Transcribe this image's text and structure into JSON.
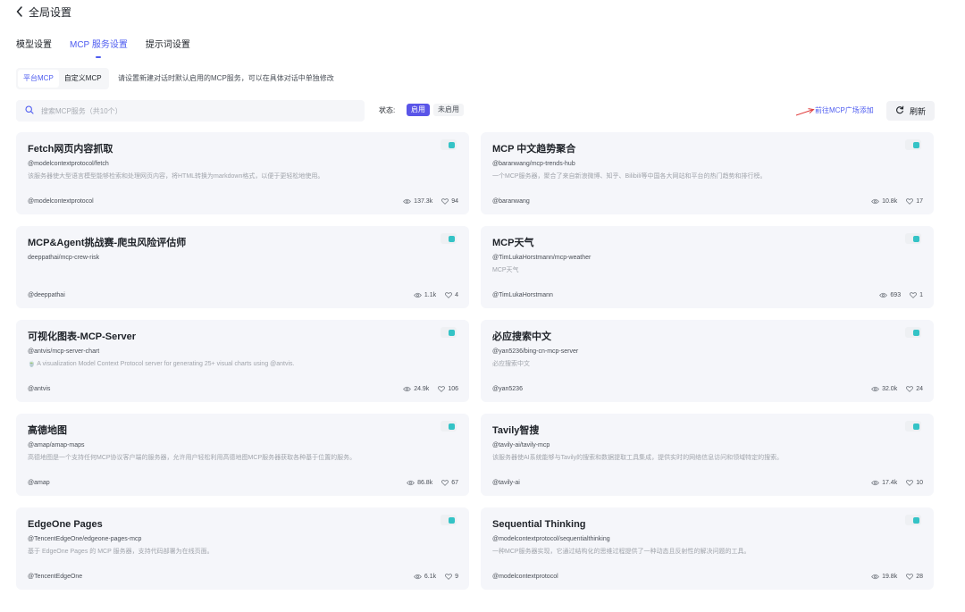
{
  "header": {
    "back_title": "全局设置"
  },
  "tabs": [
    {
      "label": "模型设置",
      "active": false
    },
    {
      "label": "MCP 服务设置",
      "active": true
    },
    {
      "label": "提示词设置",
      "active": false
    }
  ],
  "subtabs": [
    {
      "label": "平台MCP",
      "active": true
    },
    {
      "label": "自定义MCP",
      "active": false
    }
  ],
  "subtabs_hint": "请设置新建对话时默认启用的MCP服务，可以在具体对话中单独修改",
  "search": {
    "placeholder": "搜索MCP服务（共10个）",
    "value": ""
  },
  "status": {
    "label": "状态:",
    "options": [
      {
        "label": "启用",
        "active": true
      },
      {
        "label": "未启用",
        "active": false
      }
    ]
  },
  "actions": {
    "goto_label": "前往MCP广场添加",
    "refresh_label": "刷新"
  },
  "colors": {
    "accent": "#4e5cf0",
    "toggle_on": "#34c3c6",
    "card_bg": "#f5f6fa",
    "annotation_arrow": "#e03c3c"
  },
  "cards": [
    {
      "title": "Fetch网页内容抓取",
      "id": "@modelcontextprotocol/fetch",
      "desc": "该服务器使大型语言模型能够检索和处理网页内容，将HTML转换为markdown格式，以便于更轻松地使用。",
      "author": "@modelcontextprotocol",
      "views": "137.3k",
      "likes": "94",
      "enabled": true
    },
    {
      "title": "MCP 中文趋势聚合",
      "id": "@baranwang/mcp-trends-hub",
      "desc": "一个MCP服务器，聚合了来自新浪微博、知乎、Bilibili等中国各大网站和平台的热门趋势和排行榜。",
      "author": "@baranwang",
      "views": "10.8k",
      "likes": "17",
      "enabled": true
    },
    {
      "title": "MCP&Agent挑战赛-爬虫风险评估师",
      "id": "deeppathai/mcp-crew-risk",
      "desc": "",
      "author": "@deeppathai",
      "views": "1.1k",
      "likes": "4",
      "enabled": true
    },
    {
      "title": "MCP天气",
      "id": "@TimLukaHorstmann/mcp-weather",
      "desc": "MCP天气",
      "author": "@TimLukaHorstmann",
      "views": "693",
      "likes": "1",
      "enabled": true
    },
    {
      "title": "可视化图表-MCP-Server",
      "id": "@antvis/mcp-server-chart",
      "desc": "🍵 A visualization Model Context Protocol server for generating 25+ visual charts using @antvis.",
      "author": "@antvis",
      "views": "24.9k",
      "likes": "106",
      "enabled": true
    },
    {
      "title": "必应搜索中文",
      "id": "@yan5236/bing-cn-mcp-server",
      "desc": "必应搜索中文",
      "author": "@yan5236",
      "views": "32.0k",
      "likes": "24",
      "enabled": true
    },
    {
      "title": "高德地图",
      "id": "@amap/amap-maps",
      "desc": "高德地图是一个支持任何MCP协议客户端的服务器，允许用户轻松利用高德地图MCP服务器获取各种基于位置的服务。",
      "author": "@amap",
      "views": "86.8k",
      "likes": "67",
      "enabled": true
    },
    {
      "title": "Tavily智搜",
      "id": "@tavily-ai/tavily-mcp",
      "desc": "该服务器使AI系统能够与Tavily的搜索和数据提取工具集成，提供实时的网络信息访问和领域特定的搜索。",
      "author": "@tavily-ai",
      "views": "17.4k",
      "likes": "10",
      "enabled": true
    },
    {
      "title": "EdgeOne Pages",
      "id": "@TencentEdgeOne/edgeone-pages-mcp",
      "desc": "基于 EdgeOne Pages 的 MCP 服务器，支持代码部署为在线页面。",
      "author": "@TencentEdgeOne",
      "views": "6.1k",
      "likes": "9",
      "enabled": true
    },
    {
      "title": "Sequential Thinking",
      "id": "@modelcontextprotocol/sequentialthinking",
      "desc": "一种MCP服务器实现，它通过结构化的思维过程提供了一种动态且反射性的解决问题的工具。",
      "author": "@modelcontextprotocol",
      "views": "19.8k",
      "likes": "28",
      "enabled": true
    }
  ]
}
